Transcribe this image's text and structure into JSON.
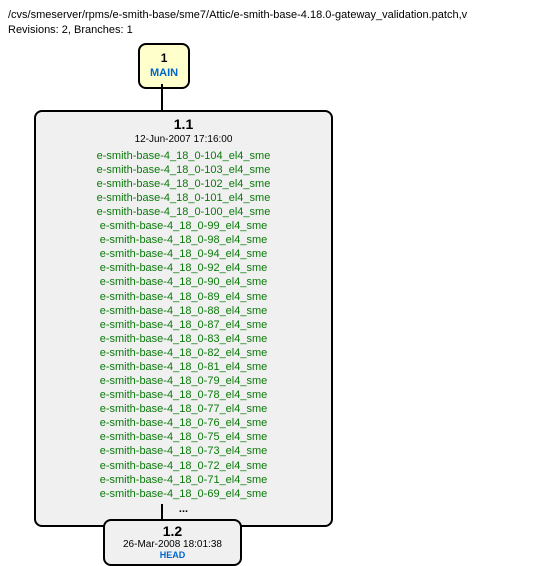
{
  "header": {
    "path": "/cvs/smeserver/rpms/e-smith-base/sme7/Attic/e-smith-base-4.18.0-gateway_validation.patch,v",
    "revisions_label": "Revisions: 2, Branches: 1"
  },
  "main_node": {
    "number": "1",
    "label": "MAIN"
  },
  "rev11": {
    "title": "1.1",
    "date": "12-Jun-2007 17:16:00",
    "tags": [
      "e-smith-base-4_18_0-104_el4_sme",
      "e-smith-base-4_18_0-103_el4_sme",
      "e-smith-base-4_18_0-102_el4_sme",
      "e-smith-base-4_18_0-101_el4_sme",
      "e-smith-base-4_18_0-100_el4_sme",
      "e-smith-base-4_18_0-99_el4_sme",
      "e-smith-base-4_18_0-98_el4_sme",
      "e-smith-base-4_18_0-94_el4_sme",
      "e-smith-base-4_18_0-92_el4_sme",
      "e-smith-base-4_18_0-90_el4_sme",
      "e-smith-base-4_18_0-89_el4_sme",
      "e-smith-base-4_18_0-88_el4_sme",
      "e-smith-base-4_18_0-87_el4_sme",
      "e-smith-base-4_18_0-83_el4_sme",
      "e-smith-base-4_18_0-82_el4_sme",
      "e-smith-base-4_18_0-81_el4_sme",
      "e-smith-base-4_18_0-79_el4_sme",
      "e-smith-base-4_18_0-78_el4_sme",
      "e-smith-base-4_18_0-77_el4_sme",
      "e-smith-base-4_18_0-76_el4_sme",
      "e-smith-base-4_18_0-75_el4_sme",
      "e-smith-base-4_18_0-73_el4_sme",
      "e-smith-base-4_18_0-72_el4_sme",
      "e-smith-base-4_18_0-71_el4_sme",
      "e-smith-base-4_18_0-69_el4_sme"
    ],
    "ellipsis": "..."
  },
  "rev12": {
    "title": "1.2",
    "date": "26-Mar-2008 18:01:38",
    "link": "HEAD"
  }
}
